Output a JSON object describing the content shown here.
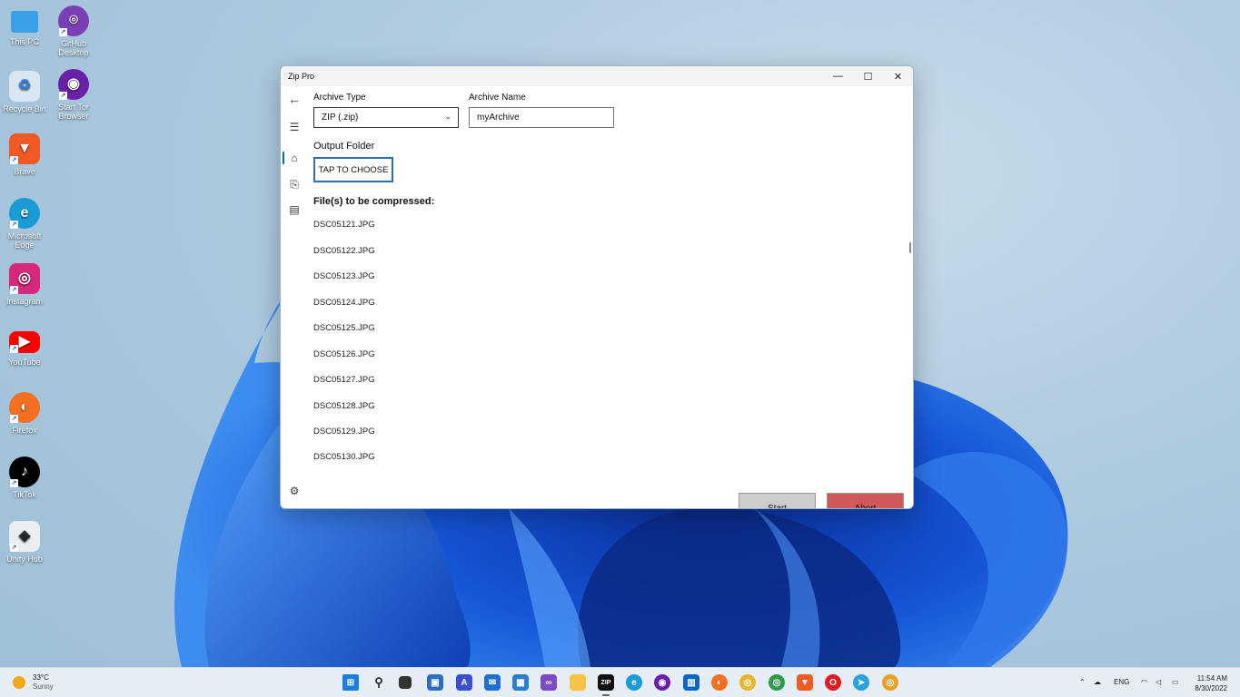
{
  "desktop": {
    "icons": [
      {
        "label": "This PC",
        "icon": "monitor-icon"
      },
      {
        "label": "GitHub Desktop",
        "icon": "github-icon"
      },
      {
        "label": "Recycle Bin",
        "icon": "recycle-bin-icon"
      },
      {
        "label": "Start Tor Browser",
        "icon": "tor-icon"
      },
      {
        "label": "Brave",
        "icon": "brave-icon"
      },
      {
        "label": "Microsoft Edge",
        "icon": "edge-icon"
      },
      {
        "label": "Instagram",
        "icon": "instagram-icon"
      },
      {
        "label": "YouTube",
        "icon": "youtube-icon"
      },
      {
        "label": "Firefox",
        "icon": "firefox-icon"
      },
      {
        "label": "TikTok",
        "icon": "tiktok-icon"
      },
      {
        "label": "Unity Hub",
        "icon": "unity-icon"
      }
    ]
  },
  "window": {
    "title": "Zip Pro",
    "archive_type_label": "Archive Type",
    "archive_type_value": "ZIP (.zip)",
    "archive_name_label": "Archive Name",
    "archive_name_value": "myArchive",
    "output_folder_label": "Output Folder",
    "choose_button": "TAP TO CHOOSE",
    "files_title": "File(s) to be compressed:",
    "files": [
      "DSC05121.JPG",
      "DSC05122.JPG",
      "DSC05123.JPG",
      "DSC05124.JPG",
      "DSC05125.JPG",
      "DSC05126.JPG",
      "DSC05127.JPG",
      "DSC05128.JPG",
      "DSC05129.JPG",
      "DSC05130.JPG"
    ],
    "start_button": "Start",
    "abort_button": "Abort",
    "colors": {
      "start_bg": "#cccccc",
      "abort_bg": "#d05a5a",
      "accent": "#0067c0"
    }
  },
  "taskbar": {
    "weather_temp": "33°C",
    "weather_desc": "Sunny",
    "language": "ENG",
    "time": "11:54 AM",
    "date": "8/30/2022"
  }
}
